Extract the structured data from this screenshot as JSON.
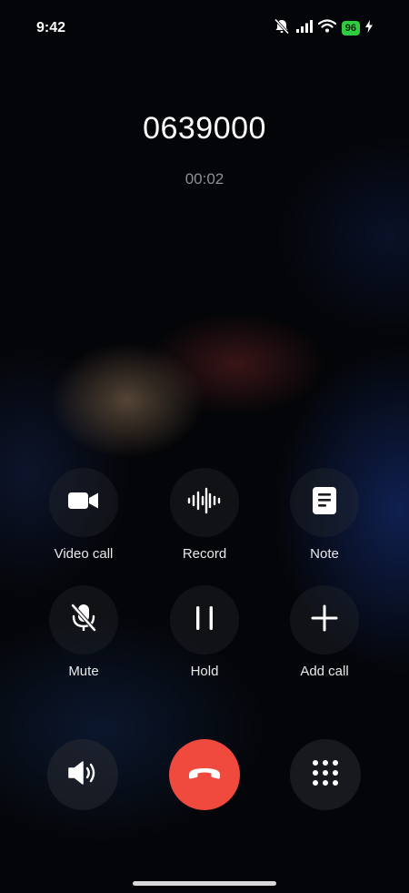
{
  "status_bar": {
    "time": "9:42",
    "battery_level": "96",
    "icons": [
      "mute-bell-icon",
      "signal-icon",
      "wifi-icon",
      "battery-icon",
      "charging-bolt-icon"
    ],
    "battery_color": "#2ecc40"
  },
  "call": {
    "number": "0639000",
    "duration": "00:02"
  },
  "controls": {
    "video_call": {
      "label": "Video call",
      "icon": "video-camera-icon"
    },
    "record": {
      "label": "Record",
      "icon": "waveform-icon"
    },
    "note": {
      "label": "Note",
      "icon": "note-icon"
    },
    "mute": {
      "label": "Mute",
      "icon": "mic-off-icon"
    },
    "hold": {
      "label": "Hold",
      "icon": "pause-icon"
    },
    "add_call": {
      "label": "Add call",
      "icon": "plus-icon"
    }
  },
  "bottom_bar": {
    "speaker_icon": "speaker-icon",
    "end_call_icon": "end-call-icon",
    "dialpad_icon": "dialpad-icon",
    "end_call_color": "#f04a3f"
  }
}
